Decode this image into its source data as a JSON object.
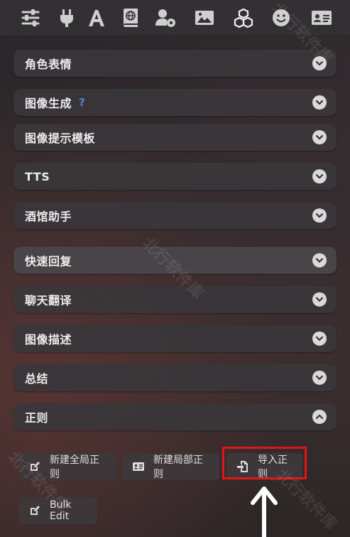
{
  "toolbar": {
    "icons": [
      "sliders-icon",
      "plug-icon",
      "font-icon",
      "book-atlas-icon",
      "user-gear-icon",
      "image-icon",
      "cubes-icon",
      "face-smile-icon",
      "id-card-icon"
    ]
  },
  "drawers": [
    {
      "label": "角色表情",
      "expanded": false
    },
    {
      "label": "图像生成",
      "help": "?",
      "expanded": false
    },
    {
      "label": "图像提示模板",
      "expanded": false
    },
    {
      "label": "TTS",
      "expanded": false
    },
    {
      "label": "酒馆助手",
      "expanded": false
    },
    {
      "label": "快速回复",
      "expanded": false
    },
    {
      "label": "聊天翻译",
      "expanded": false
    },
    {
      "label": "图像描述",
      "expanded": false
    },
    {
      "label": "总结",
      "expanded": false
    },
    {
      "label": "正则",
      "expanded": true
    }
  ],
  "regex": {
    "new_global_label": "新建全局正则",
    "new_scoped_label": "新建局部正则",
    "import_label": "导入正则",
    "bulk_edit_label": "Bulk Edit"
  },
  "watermark": "北行软件库",
  "colors": {
    "highlight": "#e0161c",
    "help_accent": "#5b86c9"
  }
}
